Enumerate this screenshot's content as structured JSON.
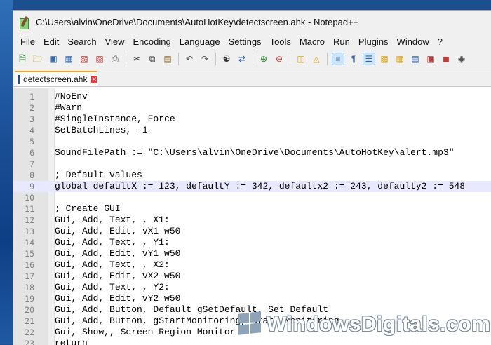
{
  "window": {
    "title": "C:\\Users\\alvin\\OneDrive\\Documents\\AutoHotKey\\detectscreen.ahk - Notepad++"
  },
  "menu": [
    "File",
    "Edit",
    "Search",
    "View",
    "Encoding",
    "Language",
    "Settings",
    "Tools",
    "Macro",
    "Run",
    "Plugins",
    "Window",
    "?"
  ],
  "toolbar": {
    "buttons": [
      "new-file-icon",
      "open-file-icon",
      "save-icon",
      "save-all-icon",
      "close-icon",
      "close-all-icon",
      "print-icon",
      "cut-icon",
      "copy-icon",
      "paste-icon",
      "undo-icon",
      "redo-icon",
      "find-icon",
      "replace-icon",
      "zoom-in-icon",
      "zoom-out-icon",
      "sync-vertical-icon",
      "sync-horizontal-icon",
      "word-wrap-icon",
      "show-all-characters-icon",
      "indent-guide-icon",
      "user-language-icon",
      "document-map-icon",
      "function-list-icon",
      "folder-as-workspace-icon",
      "monitoring-icon"
    ]
  },
  "tabs": [
    {
      "label": "detectscreen.ahk"
    }
  ],
  "editor": {
    "current_line": 9,
    "lines": [
      {
        "num": "1",
        "text": "#NoEnv"
      },
      {
        "num": "2",
        "text": "#Warn"
      },
      {
        "num": "3",
        "text": "#SingleInstance, Force"
      },
      {
        "num": "4",
        "text": "SetBatchLines, -1"
      },
      {
        "num": "5",
        "text": ""
      },
      {
        "num": "6",
        "text": "SoundFilePath := \"C:\\Users\\alvin\\OneDrive\\Documents\\AutoHotKey\\alert.mp3\""
      },
      {
        "num": "7",
        "text": ""
      },
      {
        "num": "8",
        "text": "; Default values"
      },
      {
        "num": "9",
        "text": "global defaultX := 123, defaultY := 342, defaultx2 := 243, defaulty2 := 548"
      },
      {
        "num": "10",
        "text": ""
      },
      {
        "num": "11",
        "text": "; Create GUI"
      },
      {
        "num": "12",
        "text": "Gui, Add, Text, , X1:"
      },
      {
        "num": "13",
        "text": "Gui, Add, Edit, vX1 w50"
      },
      {
        "num": "14",
        "text": "Gui, Add, Text, , Y1:"
      },
      {
        "num": "15",
        "text": "Gui, Add, Edit, vY1 w50"
      },
      {
        "num": "16",
        "text": "Gui, Add, Text, , X2:"
      },
      {
        "num": "17",
        "text": "Gui, Add, Edit, vX2 w50"
      },
      {
        "num": "18",
        "text": "Gui, Add, Text, , Y2:"
      },
      {
        "num": "19",
        "text": "Gui, Add, Edit, vY2 w50"
      },
      {
        "num": "20",
        "text": "Gui, Add, Button, Default gSetDefault, Set Default"
      },
      {
        "num": "21",
        "text": "Gui, Add, Button, gStartMonitoring, Start Monitoring"
      },
      {
        "num": "22",
        "text": "Gui, Show,, Screen Region Monitor"
      },
      {
        "num": "23",
        "text": "return"
      }
    ]
  },
  "watermark": {
    "text": "WindowsDigitals.com"
  }
}
